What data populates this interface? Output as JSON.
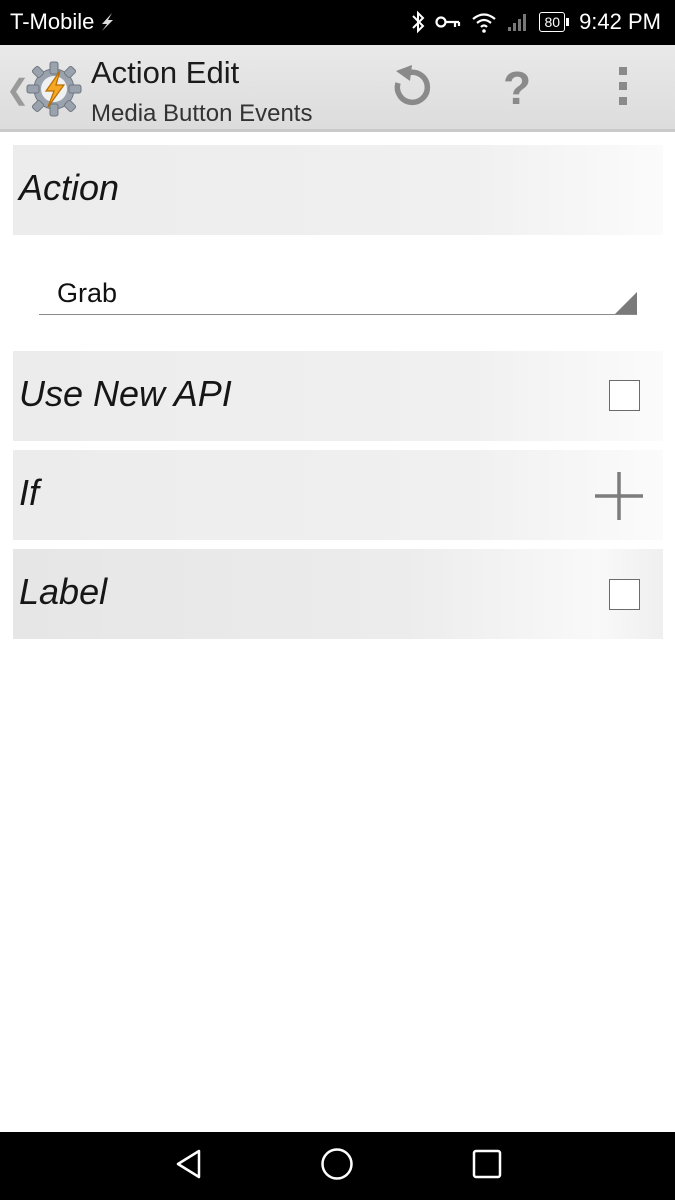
{
  "status_bar": {
    "carrier": "T-Mobile",
    "battery": "80",
    "time": "9:42 PM",
    "icons": [
      "charging-bolt-icon",
      "bluetooth-icon",
      "key-icon",
      "wifi-icon",
      "signal-icon",
      "battery-icon"
    ]
  },
  "action_bar": {
    "title": "Action Edit",
    "subtitle": "Media Button Events",
    "help_label": "?",
    "icons": [
      "back-chevron-icon",
      "tasker-logo",
      "refresh-icon",
      "help-icon",
      "overflow-menu-icon"
    ]
  },
  "form": {
    "action": {
      "label": "Action",
      "spinner_value": "Grab"
    },
    "use_new_api": {
      "label": "Use New API",
      "checked": false
    },
    "if_row": {
      "label": "If"
    },
    "label_row": {
      "label": "Label",
      "checked": false
    }
  },
  "nav_bar": {
    "icons": [
      "back-triangle-icon",
      "home-circle-icon",
      "recents-square-icon"
    ]
  },
  "colors": {
    "status_bar_bg": "#000000",
    "action_bar_bg": "#e2e2e2",
    "row_bg": "#ececec",
    "logo_orange": "#f5a623"
  }
}
